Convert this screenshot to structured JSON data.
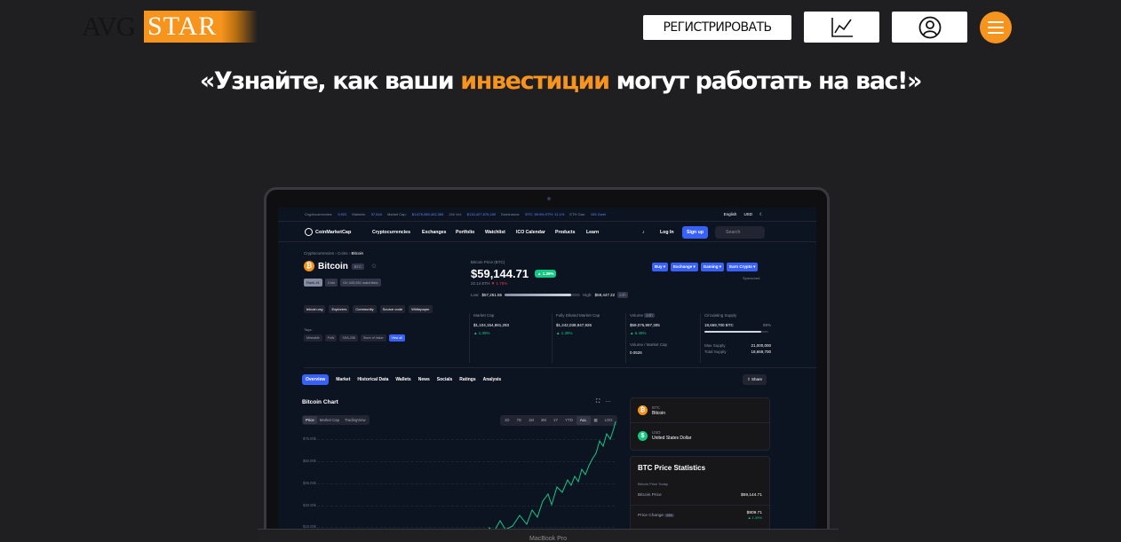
{
  "header": {
    "logo_avg": "AVG",
    "logo_star": "STAR",
    "register_label": "РЕГИСТРИРОВАТЬ"
  },
  "headline": {
    "before": "«Узнайте, как ваши ",
    "highlight": "инвестиции",
    "after": " могут работать на вас!»"
  },
  "colors": {
    "accent": "#f7941d",
    "background": "#1f1e21"
  },
  "icons": {
    "chart": "line-chart-icon",
    "user": "user-icon",
    "menu": "hamburger-menu-icon"
  },
  "laptop_screen": {
    "stats_bar": {
      "cryptos_label": "Cryptocurrencies:",
      "cryptos": "9,922",
      "markets_label": "Markets:",
      "markets": "37,644",
      "mcap_label": "Market Cap:",
      "mcap": "$1,675,065,402,365",
      "vol_label": "24h Vol:",
      "vol": "$133,427,670,180",
      "dominance_label": "Dominance:",
      "dominance": "BTC: 59.6% ETH: 11.1%",
      "gas_label": "ETH Gas:",
      "gas": "159 Gwei",
      "language": "English",
      "currency": "USD"
    },
    "nav": {
      "brand": "CoinMarketCap",
      "items": [
        "Cryptocurrencies",
        "Exchanges",
        "Portfolio",
        "Watchlist",
        "ICO Calendar",
        "Products",
        "Learn"
      ],
      "login": "Log In",
      "signup": "Sign up",
      "search_placeholder": "Search"
    },
    "breadcrumb": [
      "Cryptocurrencies",
      "Coins",
      "Bitcoin"
    ],
    "coin": {
      "name": "Bitcoin",
      "symbol": "BTC",
      "rank": "Rank #1",
      "kind": "Coin",
      "watchlists": "On 443,651 watchlists"
    },
    "price": {
      "label": "Bitcoin Price (BTC)",
      "value": "$59,144.71",
      "change": "▲ 1.39%",
      "eth": "22.14 ETH",
      "eth_change": "▼ 1.75%",
      "low_label": "Low:",
      "low": "$57,251.55",
      "high_label": "High:",
      "high": "$59,447.22",
      "period": "24h",
      "range_fraction": 0.88
    },
    "cta_buttons": [
      "Buy ▾",
      "Exchange ▾",
      "Gaming ▾",
      "Earn Crypto ▾"
    ],
    "sponsored": "Sponsored",
    "links": [
      "bitcoin.org",
      "Explorers",
      "Community",
      "Source code",
      "Whitepaper"
    ],
    "tags_label": "Tags:",
    "tags": [
      "Mineable",
      "PoW",
      "SHA-256",
      "Store of Value",
      "View all"
    ],
    "stats": [
      {
        "label": "Market Cap",
        "value": "$1,104,154,881,293",
        "change": "▲ 1.39%"
      },
      {
        "label": "Fully Diluted Market Cap",
        "value": "$1,242,038,947,926",
        "change": "▲ 1.39%"
      },
      {
        "label": "Volume",
        "value": "$59,075,997,305",
        "change": "▲ 6.49%",
        "tag": "24h",
        "sub_label": "Volume / Market Cap",
        "sub_value": "0.0526"
      },
      {
        "label": "Circulating Supply",
        "value": "18,669,700 BTC",
        "pct": "89%",
        "max_label": "Max Supply",
        "max": "21,000,000",
        "total_label": "Total Supply",
        "total": "18,669,700",
        "supply_fraction": 0.89
      }
    ],
    "tabs": [
      "Overview",
      "Market",
      "Historical Data",
      "Wallets",
      "News",
      "Socials",
      "Ratings",
      "Analysis"
    ],
    "share": "Share",
    "chart": {
      "title": "Bitcoin Chart",
      "type_tabs": [
        "Price",
        "Market Cap",
        "TradingView"
      ],
      "ranges": [
        "1D",
        "7D",
        "1M",
        "3M",
        "1Y",
        "YTD",
        "ALL",
        "LOG"
      ],
      "ylabels": [
        "$75.00k",
        "$60.00k",
        "$45.00k",
        "$30.00k",
        "$15.00k"
      ]
    },
    "converter": [
      {
        "symbol": "BTC",
        "name": "Bitcoin"
      },
      {
        "symbol": "USD",
        "name": "United States Dollar"
      }
    ],
    "price_stats": {
      "title": "BTC Price Statistics",
      "subtitle": "Bitcoin Price Today",
      "rows": [
        {
          "label": "Bitcoin Price",
          "value": "$59,144.71"
        },
        {
          "label": "Price Change",
          "tag": "24h",
          "value": "$809.71",
          "change": "▲ 1.39%"
        }
      ]
    }
  },
  "laptop_base": "MacBook Pro"
}
